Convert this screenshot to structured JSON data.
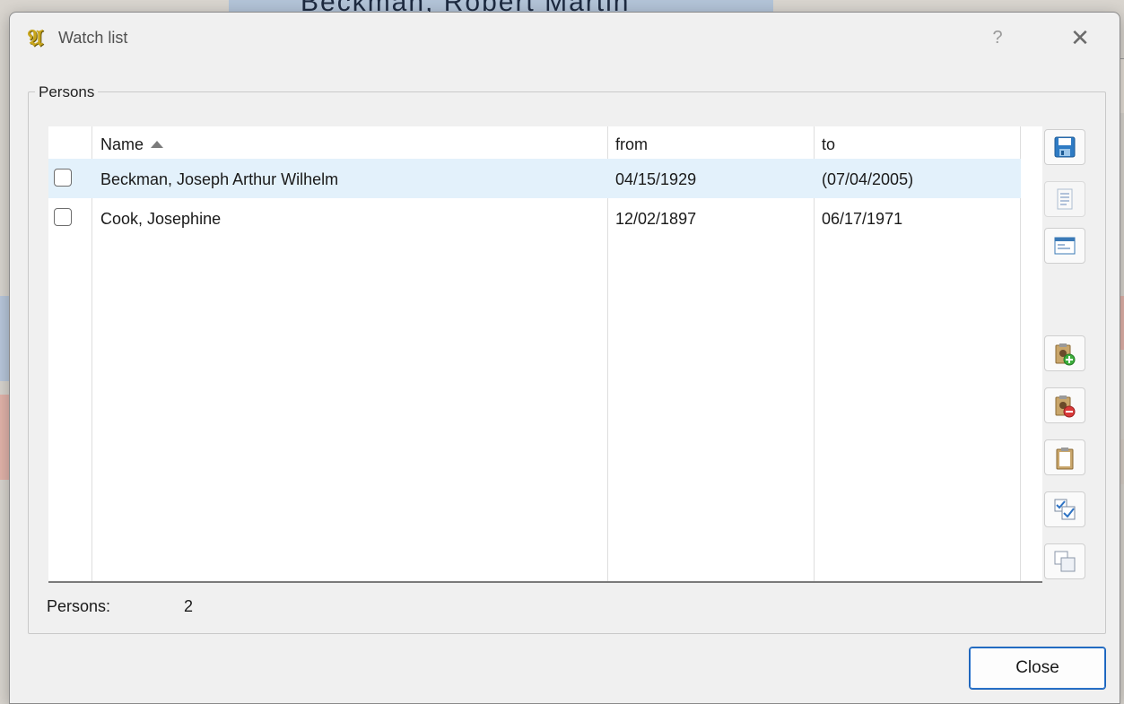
{
  "dialog": {
    "title": "Watch list",
    "app_icon_glyph": "𝔄",
    "help_label": "?",
    "close_glyph": "✕"
  },
  "background": {
    "top_text": "Beckman, Robert Martin"
  },
  "group": {
    "title": "Persons"
  },
  "table": {
    "columns": {
      "name": "Name",
      "from": "from",
      "to": "to"
    },
    "sort_column": "Name",
    "sort_direction": "ascending",
    "rows": [
      {
        "checked": false,
        "name": "Beckman, Joseph Arthur Wilhelm",
        "from": "04/15/1929",
        "to": "(07/04/2005)",
        "selected": true
      },
      {
        "checked": false,
        "name": "Cook, Josephine",
        "from": "12/02/1897",
        "to": "06/17/1971",
        "selected": false
      }
    ]
  },
  "toolbar": {
    "buttons": [
      {
        "icon": "save-icon",
        "enabled": true
      },
      {
        "icon": "document-icon",
        "enabled": false
      },
      {
        "icon": "form-icon",
        "enabled": true
      },
      {
        "icon": "add-person-icon",
        "enabled": true
      },
      {
        "icon": "remove-person-icon",
        "enabled": true
      },
      {
        "icon": "clipboard-icon",
        "enabled": true
      },
      {
        "icon": "check-all-icon",
        "enabled": true
      },
      {
        "icon": "copy-icon",
        "enabled": true
      }
    ]
  },
  "status": {
    "label": "Persons:",
    "count": "2"
  },
  "footer": {
    "close_label": "Close"
  },
  "colors": {
    "selected_row": "#e3f1fb",
    "accent": "#1a62b8"
  }
}
